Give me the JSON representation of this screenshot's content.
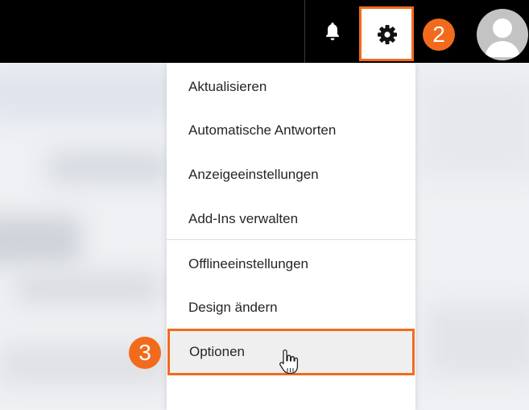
{
  "header": {
    "notification_icon": "bell-icon",
    "settings_icon": "gear-icon",
    "step_badge": "2",
    "avatar_icon": "user-icon",
    "accent_color": "#f26b1d"
  },
  "menu": {
    "items": [
      {
        "label": "Aktualisieren"
      },
      {
        "label": "Automatische Antworten"
      },
      {
        "label": "Anzeigeeinstellungen"
      },
      {
        "label": "Add-Ins verwalten"
      },
      {
        "label": "Offlineeinstellungen"
      },
      {
        "label": "Design ändern"
      },
      {
        "label": "Optionen"
      }
    ],
    "step_badge": "3",
    "cursor_icon": "hand-pointer-icon"
  }
}
